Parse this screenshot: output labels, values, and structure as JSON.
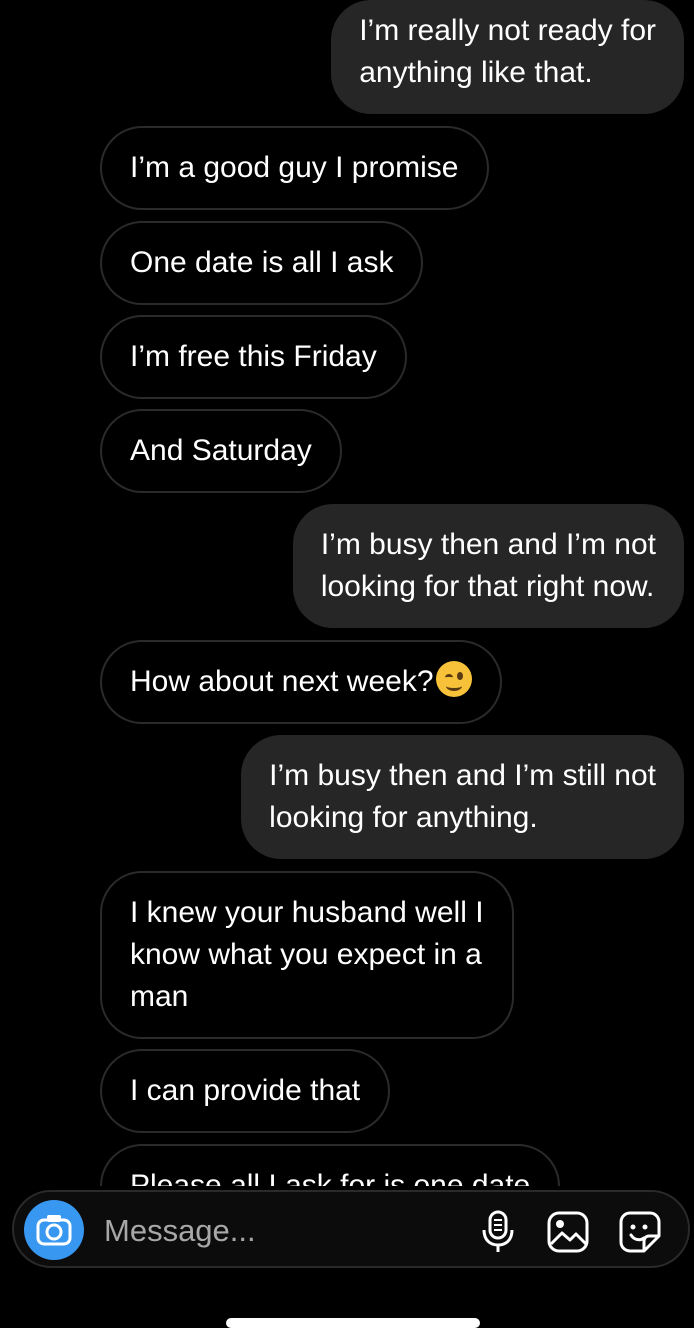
{
  "messages": [
    {
      "id": "m1",
      "direction": "outgoing",
      "lines": [
        "I’m really not ready for",
        "anything like that."
      ]
    },
    {
      "id": "m2",
      "direction": "incoming",
      "lines": [
        "I’m a good guy I promise"
      ]
    },
    {
      "id": "m3",
      "direction": "incoming",
      "lines": [
        "One date is all I ask"
      ]
    },
    {
      "id": "m4",
      "direction": "incoming",
      "lines": [
        "I’m free this Friday"
      ]
    },
    {
      "id": "m5",
      "direction": "incoming",
      "lines": [
        "And Saturday"
      ]
    },
    {
      "id": "m6",
      "direction": "outgoing",
      "lines": [
        "I’m busy then and I’m not",
        "looking for that right now."
      ]
    },
    {
      "id": "m7",
      "direction": "incoming",
      "lines": [
        "How about next week?"
      ],
      "emoji": "winking-face-emoji"
    },
    {
      "id": "m8",
      "direction": "outgoing",
      "lines": [
        "I’m busy then and I’m still not",
        "looking for anything."
      ]
    },
    {
      "id": "m9",
      "direction": "incoming",
      "lines": [
        "I knew your husband well I",
        "know what you expect in a",
        "man"
      ]
    },
    {
      "id": "m10",
      "direction": "incoming",
      "lines": [
        "I can provide that"
      ]
    },
    {
      "id": "m11",
      "direction": "incoming",
      "lines": [
        "Please all I ask for is one date"
      ]
    }
  ],
  "composer": {
    "placeholder": "Message...",
    "icons": [
      "camera-icon",
      "microphone-icon",
      "gallery-icon",
      "sticker-icon"
    ]
  },
  "colors": {
    "background": "#000000",
    "outgoing_bubble": "#262626",
    "incoming_border": "#2a2a2a",
    "accent": "#3897f0",
    "placeholder": "#a8a8a8"
  }
}
